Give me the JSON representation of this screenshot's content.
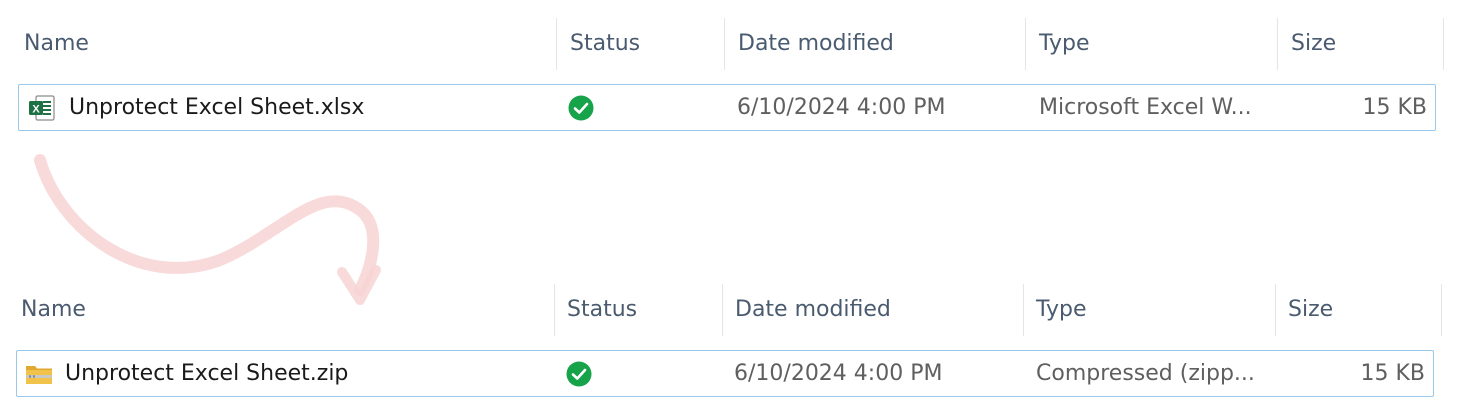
{
  "columns": {
    "name": "Name",
    "status": "Status",
    "date_modified": "Date modified",
    "type": "Type",
    "size": "Size"
  },
  "panels": [
    {
      "file": {
        "icon": "excel-file-icon",
        "name": "Unprotect Excel Sheet.xlsx",
        "status_icon": "synced-check-icon",
        "date_modified": "6/10/2024 4:00 PM",
        "type": "Microsoft Excel W...",
        "size": "15 KB"
      }
    },
    {
      "file": {
        "icon": "zip-folder-icon",
        "name": "Unprotect Excel Sheet.zip",
        "status_icon": "synced-check-icon",
        "date_modified": "6/10/2024 4:00 PM",
        "type": "Compressed (zipp...",
        "size": "15 KB"
      }
    }
  ],
  "colors": {
    "header_text": "#4a5b70",
    "row_border": "#99c8eb",
    "status_green": "#16a34a",
    "excel_green": "#1e7145",
    "zip_yellow": "#f2c34a",
    "arrow_pink": "#f7d3d3"
  }
}
